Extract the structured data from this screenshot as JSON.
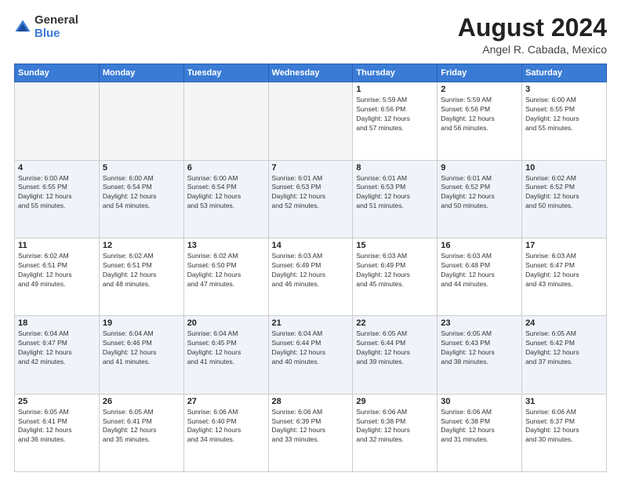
{
  "logo": {
    "general": "General",
    "blue": "Blue"
  },
  "title": {
    "month_year": "August 2024",
    "location": "Angel R. Cabada, Mexico"
  },
  "weekdays": [
    "Sunday",
    "Monday",
    "Tuesday",
    "Wednesday",
    "Thursday",
    "Friday",
    "Saturday"
  ],
  "weeks": [
    [
      {
        "day": "",
        "info": "",
        "empty": true
      },
      {
        "day": "",
        "info": "",
        "empty": true
      },
      {
        "day": "",
        "info": "",
        "empty": true
      },
      {
        "day": "",
        "info": "",
        "empty": true
      },
      {
        "day": "1",
        "info": "Sunrise: 5:59 AM\nSunset: 6:56 PM\nDaylight: 12 hours\nand 57 minutes."
      },
      {
        "day": "2",
        "info": "Sunrise: 5:59 AM\nSunset: 6:56 PM\nDaylight: 12 hours\nand 56 minutes."
      },
      {
        "day": "3",
        "info": "Sunrise: 6:00 AM\nSunset: 6:55 PM\nDaylight: 12 hours\nand 55 minutes."
      }
    ],
    [
      {
        "day": "4",
        "info": "Sunrise: 6:00 AM\nSunset: 6:55 PM\nDaylight: 12 hours\nand 55 minutes."
      },
      {
        "day": "5",
        "info": "Sunrise: 6:00 AM\nSunset: 6:54 PM\nDaylight: 12 hours\nand 54 minutes."
      },
      {
        "day": "6",
        "info": "Sunrise: 6:00 AM\nSunset: 6:54 PM\nDaylight: 12 hours\nand 53 minutes."
      },
      {
        "day": "7",
        "info": "Sunrise: 6:01 AM\nSunset: 6:53 PM\nDaylight: 12 hours\nand 52 minutes."
      },
      {
        "day": "8",
        "info": "Sunrise: 6:01 AM\nSunset: 6:53 PM\nDaylight: 12 hours\nand 51 minutes."
      },
      {
        "day": "9",
        "info": "Sunrise: 6:01 AM\nSunset: 6:52 PM\nDaylight: 12 hours\nand 50 minutes."
      },
      {
        "day": "10",
        "info": "Sunrise: 6:02 AM\nSunset: 6:52 PM\nDaylight: 12 hours\nand 50 minutes."
      }
    ],
    [
      {
        "day": "11",
        "info": "Sunrise: 6:02 AM\nSunset: 6:51 PM\nDaylight: 12 hours\nand 49 minutes."
      },
      {
        "day": "12",
        "info": "Sunrise: 6:02 AM\nSunset: 6:51 PM\nDaylight: 12 hours\nand 48 minutes."
      },
      {
        "day": "13",
        "info": "Sunrise: 6:02 AM\nSunset: 6:50 PM\nDaylight: 12 hours\nand 47 minutes."
      },
      {
        "day": "14",
        "info": "Sunrise: 6:03 AM\nSunset: 6:49 PM\nDaylight: 12 hours\nand 46 minutes."
      },
      {
        "day": "15",
        "info": "Sunrise: 6:03 AM\nSunset: 6:49 PM\nDaylight: 12 hours\nand 45 minutes."
      },
      {
        "day": "16",
        "info": "Sunrise: 6:03 AM\nSunset: 6:48 PM\nDaylight: 12 hours\nand 44 minutes."
      },
      {
        "day": "17",
        "info": "Sunrise: 6:03 AM\nSunset: 6:47 PM\nDaylight: 12 hours\nand 43 minutes."
      }
    ],
    [
      {
        "day": "18",
        "info": "Sunrise: 6:04 AM\nSunset: 6:47 PM\nDaylight: 12 hours\nand 42 minutes."
      },
      {
        "day": "19",
        "info": "Sunrise: 6:04 AM\nSunset: 6:46 PM\nDaylight: 12 hours\nand 41 minutes."
      },
      {
        "day": "20",
        "info": "Sunrise: 6:04 AM\nSunset: 6:45 PM\nDaylight: 12 hours\nand 41 minutes."
      },
      {
        "day": "21",
        "info": "Sunrise: 6:04 AM\nSunset: 6:44 PM\nDaylight: 12 hours\nand 40 minutes."
      },
      {
        "day": "22",
        "info": "Sunrise: 6:05 AM\nSunset: 6:44 PM\nDaylight: 12 hours\nand 39 minutes."
      },
      {
        "day": "23",
        "info": "Sunrise: 6:05 AM\nSunset: 6:43 PM\nDaylight: 12 hours\nand 38 minutes."
      },
      {
        "day": "24",
        "info": "Sunrise: 6:05 AM\nSunset: 6:42 PM\nDaylight: 12 hours\nand 37 minutes."
      }
    ],
    [
      {
        "day": "25",
        "info": "Sunrise: 6:05 AM\nSunset: 6:41 PM\nDaylight: 12 hours\nand 36 minutes."
      },
      {
        "day": "26",
        "info": "Sunrise: 6:05 AM\nSunset: 6:41 PM\nDaylight: 12 hours\nand 35 minutes."
      },
      {
        "day": "27",
        "info": "Sunrise: 6:06 AM\nSunset: 6:40 PM\nDaylight: 12 hours\nand 34 minutes."
      },
      {
        "day": "28",
        "info": "Sunrise: 6:06 AM\nSunset: 6:39 PM\nDaylight: 12 hours\nand 33 minutes."
      },
      {
        "day": "29",
        "info": "Sunrise: 6:06 AM\nSunset: 6:38 PM\nDaylight: 12 hours\nand 32 minutes."
      },
      {
        "day": "30",
        "info": "Sunrise: 6:06 AM\nSunset: 6:38 PM\nDaylight: 12 hours\nand 31 minutes."
      },
      {
        "day": "31",
        "info": "Sunrise: 6:06 AM\nSunset: 6:37 PM\nDaylight: 12 hours\nand 30 minutes."
      }
    ]
  ]
}
